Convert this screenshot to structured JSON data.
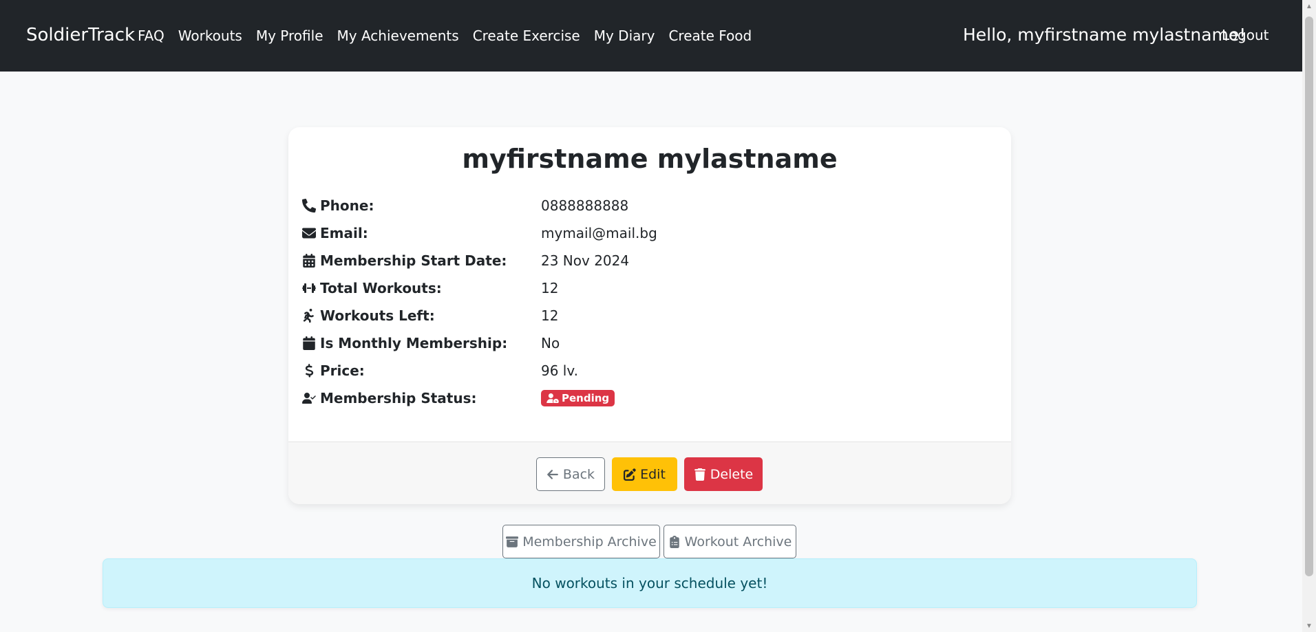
{
  "navbar": {
    "brand": "SoldierTrack",
    "links": [
      "FAQ",
      "Workouts",
      "My Profile",
      "My Achievements",
      "Create Exercise",
      "My Diary",
      "Create Food"
    ],
    "greeting": "Hello, myfirstname mylastname!",
    "logout": "Logout"
  },
  "profile": {
    "name": "myfirstname mylastname",
    "fields": [
      {
        "label": "Phone:",
        "value": "0888888888",
        "icon": "phone-icon"
      },
      {
        "label": "Email:",
        "value": "mymail@mail.bg",
        "icon": "envelope-icon"
      },
      {
        "label": "Membership Start Date:",
        "value": "23 Nov 2024",
        "icon": "calendar-days-icon"
      },
      {
        "label": "Total Workouts:",
        "value": "12",
        "icon": "dumbbell-icon"
      },
      {
        "label": "Workouts Left:",
        "value": "12",
        "icon": "running-person-icon"
      },
      {
        "label": "Is Monthly Membership:",
        "value": "No",
        "icon": "calendar-icon"
      },
      {
        "label": "Price:",
        "value": "96 lv.",
        "icon": "dollar-icon"
      },
      {
        "label": "Membership Status:",
        "value": "Pending",
        "icon": "user-check-icon"
      }
    ],
    "status_color": "#dc3545"
  },
  "actions": {
    "back": "Back",
    "edit": "Edit",
    "delete": "Delete"
  },
  "archives": {
    "membership": "Membership Archive",
    "workout": "Workout Archive"
  },
  "alert": {
    "message": "No workouts in your schedule yet!"
  },
  "colors": {
    "navbar": "#212529",
    "warning": "#ffc107",
    "danger": "#dc3545",
    "info_bg": "#cff4fc"
  }
}
